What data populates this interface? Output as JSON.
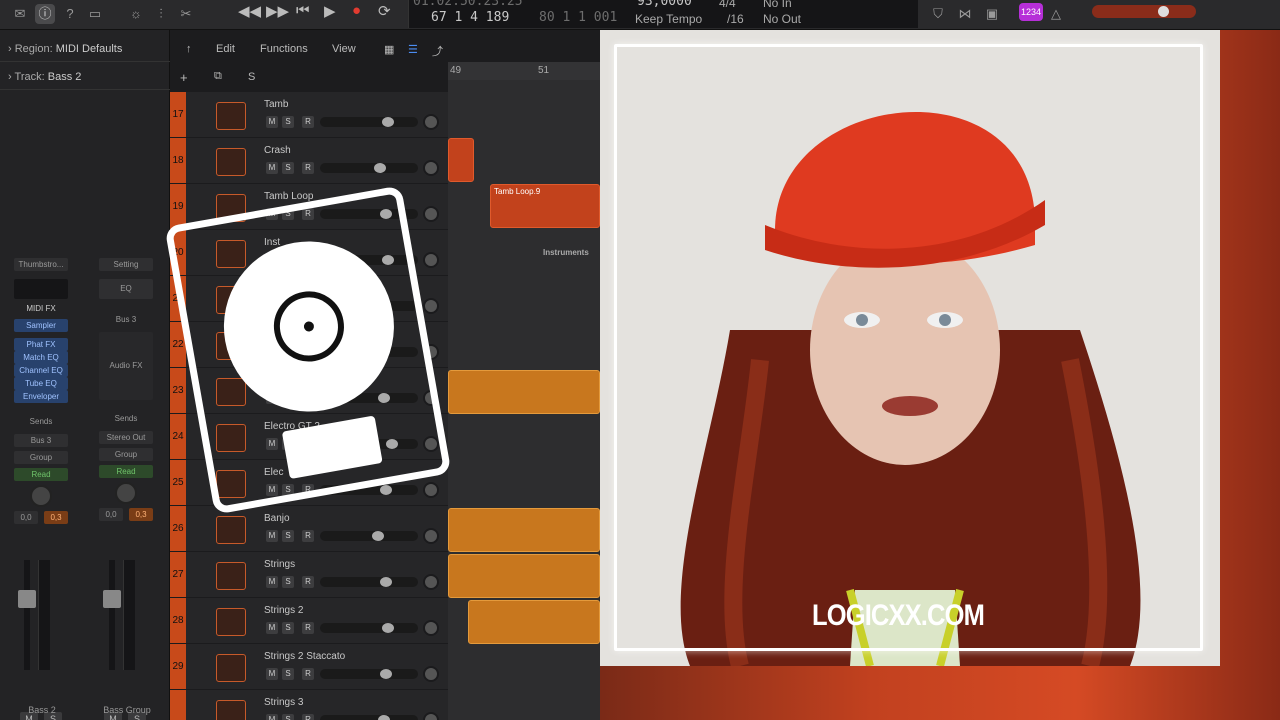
{
  "topbar": {
    "timecode": "01:02:50:23.25",
    "bars": "67  1  4  189",
    "bars_dim": "80  1  1  001",
    "tempo": "93,0000",
    "tempo_mode": "Keep Tempo",
    "signature": "4/4",
    "division": "/16",
    "input": "No In",
    "output": "No Out",
    "count_badge": "1234"
  },
  "inspector": {
    "region_label": "Region:",
    "region_value": "MIDI Defaults",
    "track_label": "Track:",
    "track_value": "Bass 2"
  },
  "strip1": {
    "setting": "Thumbstro...",
    "midi_fx": "MIDI FX",
    "plugins": [
      "Sampler",
      "Phat FX",
      "Match EQ",
      "Channel EQ",
      "Tube EQ",
      "Enveloper"
    ],
    "sends": "Sends",
    "bus": "Bus 3",
    "group": "Group",
    "read": "Read",
    "pan_a": "0,0",
    "pan_b": "0,3",
    "mute": "M",
    "solo": "S",
    "name": "Bass 2"
  },
  "strip2": {
    "setting": "Setting",
    "eq": "EQ",
    "link": "Bus 3",
    "audio_fx": "Audio FX",
    "sends": "Sends",
    "out": "Stereo Out",
    "group": "Group",
    "read": "Read",
    "pan_a": "0,0",
    "pan_b": "0,3",
    "mute": "M",
    "solo": "S",
    "name": "Bass Group"
  },
  "menus": {
    "edit": "Edit",
    "functions": "Functions",
    "view": "View",
    "s": "S"
  },
  "ruler": {
    "a": "49",
    "b": "51"
  },
  "tracks": [
    {
      "num": "17",
      "name": "Tamb"
    },
    {
      "num": "18",
      "name": "Crash"
    },
    {
      "num": "19",
      "name": "Tamb Loop"
    },
    {
      "num": "20",
      "name": "Inst"
    },
    {
      "num": "21",
      "name": "Instruments"
    },
    {
      "num": "22",
      "name": ""
    },
    {
      "num": "23",
      "name": ""
    },
    {
      "num": "24",
      "name": "Electro GT 2"
    },
    {
      "num": "25",
      "name": "Elec"
    },
    {
      "num": "26",
      "name": "Banjo"
    },
    {
      "num": "27",
      "name": "Strings"
    },
    {
      "num": "28",
      "name": "Strings 2"
    },
    {
      "num": "29",
      "name": "Strings 2 Staccato"
    },
    {
      "num": "",
      "name": "Strings 3"
    }
  ],
  "buttons": {
    "m": "M",
    "s": "S",
    "r": "R"
  },
  "regions": {
    "tamb_loop": "Tamb Loop.9",
    "instruments": "Instruments"
  },
  "watermark": "LOGICXX.COM"
}
